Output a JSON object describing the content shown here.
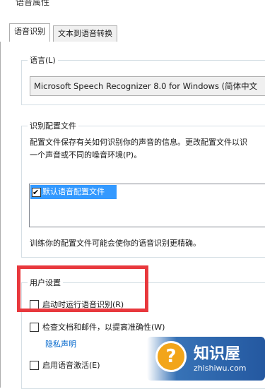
{
  "window": {
    "title": "语音属性"
  },
  "tabs": [
    {
      "label": "语音识别",
      "active": true
    },
    {
      "label": "文本到语音转换",
      "active": false
    }
  ],
  "language": {
    "group_label": "语言(L)",
    "selected": "Microsoft Speech Recognizer 8.0 for Windows (简体中文"
  },
  "profiles": {
    "group_label": "识别配置文件",
    "description_line1": "配置文件保存有关如何识别你的声音的信息。更改配置文件以识",
    "description_line2": "一个声音或不同的噪音环境(P)。",
    "items": [
      {
        "label": "默认语音配置文件",
        "checked": true,
        "selected": true
      }
    ],
    "training_note": "训练你的配置文件可能会使你的语音识别更精确。"
  },
  "user_settings": {
    "group_label": "用户设置",
    "options": [
      {
        "label": "启动时运行语音识别(R)",
        "checked": false
      },
      {
        "label": "检查文档和邮件，以提高准确性(W)",
        "checked": false
      },
      {
        "label": "启用语音激活(E)",
        "checked": false
      }
    ],
    "privacy_link": "隐私声明"
  },
  "watermark": {
    "icon": "question-bulb-icon",
    "brand": "知识屋",
    "domain": "zhishiwu.com"
  },
  "colors": {
    "highlight": "#e8383d",
    "selection": "#3399ff",
    "link": "#0066cc"
  }
}
